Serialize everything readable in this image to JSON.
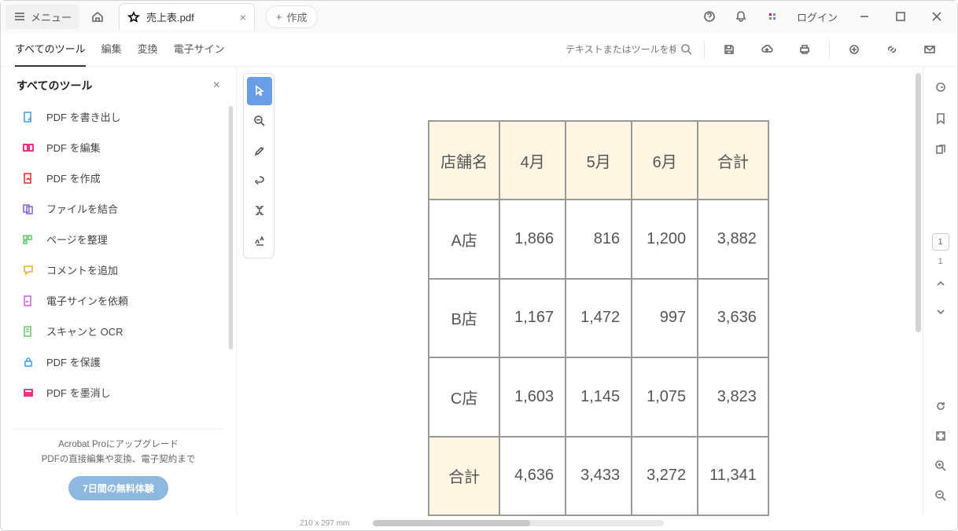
{
  "titlebar": {
    "menu": "メニュー",
    "filename": "売上表.pdf",
    "create": "作成",
    "login": "ログイン"
  },
  "toolbar": {
    "tabs": [
      "すべてのツール",
      "編集",
      "変換",
      "電子サイン"
    ],
    "searchPlaceholder": "テキストまたはツールを検索"
  },
  "sidebar": {
    "title": "すべてのツール",
    "items": [
      "PDF を書き出し",
      "PDF を編集",
      "PDF を作成",
      "ファイルを結合",
      "ページを整理",
      "コメントを追加",
      "電子サインを依頼",
      "スキャンと OCR",
      "PDF を保護",
      "PDF を墨消し"
    ],
    "upgrade1": "Acrobat Proにアップグレード",
    "upgrade2": "PDFの直接編集や変換、電子契約まで",
    "trial": "7日間の無料体験"
  },
  "chart_data": {
    "type": "table",
    "title": "売上表",
    "headers": [
      "店舗名",
      "4月",
      "5月",
      "6月",
      "合計"
    ],
    "rows": [
      [
        "A店",
        "1,866",
        "816",
        "1,200",
        "3,882"
      ],
      [
        "B店",
        "1,167",
        "1,472",
        "997",
        "3,636"
      ],
      [
        "C店",
        "1,603",
        "1,145",
        "1,075",
        "3,823"
      ],
      [
        "合計",
        "4,636",
        "3,433",
        "3,272",
        "11,341"
      ]
    ]
  },
  "pagenav": {
    "current": "1",
    "total": "1"
  },
  "status": {
    "size": "210 x 297 mm"
  }
}
